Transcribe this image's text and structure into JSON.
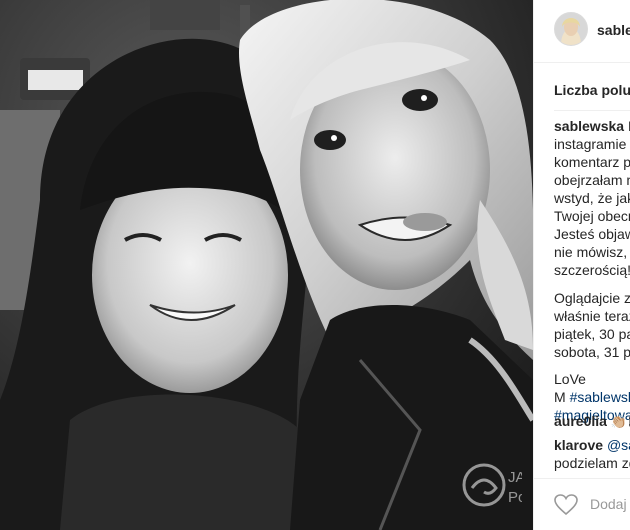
{
  "post": {
    "username": "sablewska",
    "likes_label": "Liczba polub",
    "caption": {
      "author": "sablewska",
      "lines": [
        "Ki",
        "instagramie @",
        "komentarz po",
        "obejrzałam m",
        "wstyd, że jak",
        "Twojej obecn",
        "Jesteś objaw",
        "nie mówisz, T",
        "szczerością!"
      ],
      "para2": [
        "Oglądajcie ze",
        "właśnie teraz",
        "piątek, 30 pa",
        "sobota, 31 pa"
      ],
      "sign": [
        "LoVe",
        "M "
      ],
      "hashtags": [
        "#sablewsk",
        "#magieltowa"
      ]
    },
    "comments": [
      {
        "user": "aure0lia",
        "text": "👏🏼🎞"
      },
      {
        "user": "klarove",
        "text": "@sab",
        "cont": "podzielam zd"
      }
    ],
    "add_comment_placeholder": "Dodaj k",
    "watermark_text": [
      "JA",
      "Po"
    ]
  },
  "icons": {
    "heart": "heart-outline-icon",
    "logo": "watermark-logo"
  },
  "colors": {
    "link": "#003569",
    "text": "#262626",
    "muted": "#999999",
    "heart_red": "#ed4956"
  }
}
